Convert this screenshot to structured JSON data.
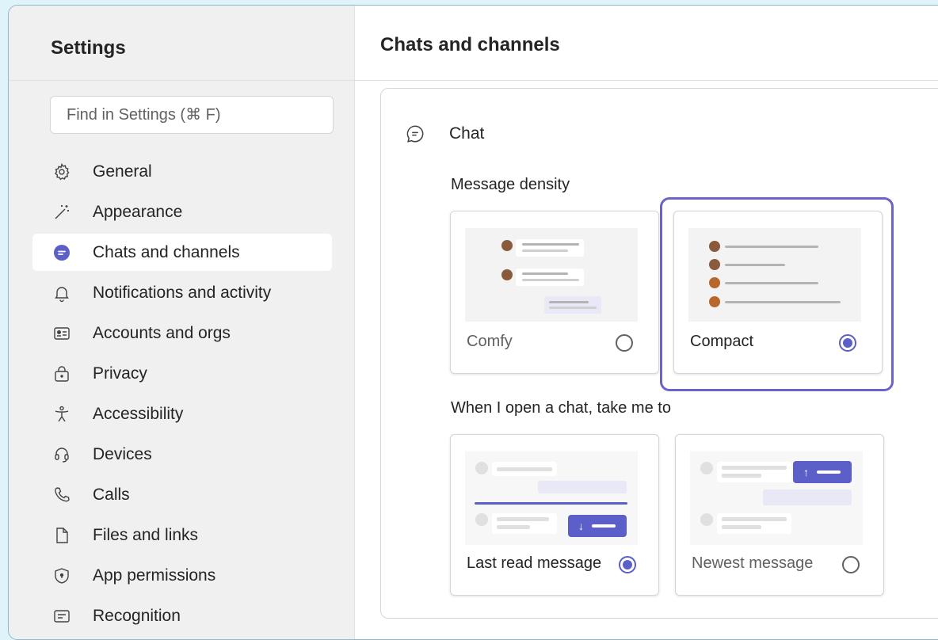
{
  "sidebar": {
    "title": "Settings",
    "search_placeholder": "Find in Settings (⌘ F)",
    "items": [
      {
        "label": "General",
        "icon": "gear-icon"
      },
      {
        "label": "Appearance",
        "icon": "magic-wand-icon"
      },
      {
        "label": "Chats and channels",
        "icon": "chat-bubble-icon",
        "active": true
      },
      {
        "label": "Notifications and activity",
        "icon": "bell-icon"
      },
      {
        "label": "Accounts and orgs",
        "icon": "id-card-icon"
      },
      {
        "label": "Privacy",
        "icon": "lock-icon"
      },
      {
        "label": "Accessibility",
        "icon": "accessibility-icon"
      },
      {
        "label": "Devices",
        "icon": "headset-icon"
      },
      {
        "label": "Calls",
        "icon": "phone-icon"
      },
      {
        "label": "Files and links",
        "icon": "document-icon"
      },
      {
        "label": "App permissions",
        "icon": "shield-icon"
      },
      {
        "label": "Recognition",
        "icon": "recognition-icon"
      }
    ]
  },
  "main": {
    "title": "Chats and channels",
    "section_title": "Chat",
    "density": {
      "label": "Message density",
      "options": [
        {
          "label": "Comfy",
          "selected": false
        },
        {
          "label": "Compact",
          "selected": true
        }
      ]
    },
    "open_chat": {
      "label": "When I open a chat, take me to",
      "options": [
        {
          "label": "Last read message",
          "selected": true
        },
        {
          "label": "Newest message",
          "selected": false
        }
      ]
    }
  },
  "colors": {
    "accent": "#5b5fc7",
    "focus_ring": "#6b63c9",
    "background": "#dff3fb"
  }
}
